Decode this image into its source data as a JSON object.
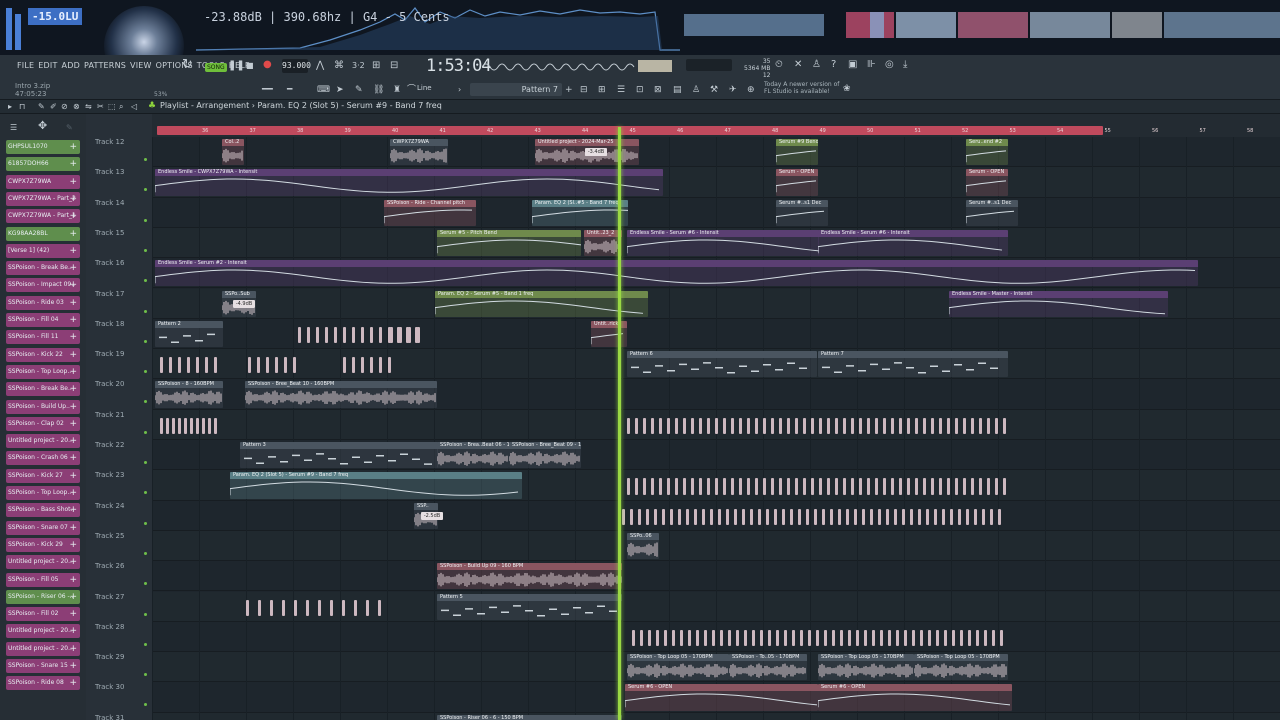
{
  "visualizer": {
    "lufs": "-15.0LU",
    "readout": "-23.88dB | 390.68hz | G4 - 5 Cents"
  },
  "menu": [
    "FILE",
    "EDIT",
    "ADD",
    "PATTERNS",
    "VIEW",
    "OPTIONS",
    "TOOLS",
    "HELP"
  ],
  "project": {
    "name": "Intro 3.zip",
    "pos": "47:05:23"
  },
  "transport": {
    "song_label": "SONG",
    "tempo": "93.000",
    "time": "1:53:04",
    "snap": "Line",
    "pattern": "Pattern 7",
    "zoom": "53%"
  },
  "memory": {
    "ram": "5364 MB",
    "cpu_top": "35",
    "cpu_bot": "12"
  },
  "news": {
    "line1": "Today  A newer version of",
    "line2": "FL Studio is available!"
  },
  "playlist": {
    "title": "Playlist - Arrangement",
    "sep": "›",
    "context": "Param. EQ 2 (Slot 5) - Serum #9 - Band 7 freq"
  },
  "ruler": [
    "36",
    "37",
    "38",
    "39",
    "40",
    "41",
    "42",
    "43",
    "44",
    "45",
    "46",
    "47",
    "48",
    "49",
    "50",
    "51",
    "52",
    "53",
    "54",
    "55",
    "56",
    "57",
    "58"
  ],
  "channels": [
    {
      "name": "GHPSUL1070",
      "color": "#5f8e4d"
    },
    {
      "name": "61857DOH66",
      "color": "#5f8e4d"
    },
    {
      "name": "CWPX7Z79WA",
      "color": "#8c3e76"
    },
    {
      "name": "CWPX7Z79WA - Part_2",
      "color": "#8c3e76"
    },
    {
      "name": "CWPX7Z79WA - Part_1",
      "color": "#8c3e76"
    },
    {
      "name": "KG98AA28BL",
      "color": "#5f8e4d"
    },
    {
      "name": "[Verse 1] (42)",
      "color": "#8c3e76"
    },
    {
      "name": "SSPoison - Break Be..",
      "color": "#8c3e76"
    },
    {
      "name": "SSPoison - Impact 09..",
      "color": "#8c3e76"
    },
    {
      "name": "SSPoison - Ride 03",
      "color": "#8c3e76"
    },
    {
      "name": "SSPoison - Fill 04",
      "color": "#8c3e76"
    },
    {
      "name": "SSPoison - Fill 11",
      "color": "#8c3e76"
    },
    {
      "name": "SSPoison - Kick 22",
      "color": "#8c3e76"
    },
    {
      "name": "SSPoison - Top Loop..",
      "color": "#8c3e76"
    },
    {
      "name": "SSPoison - Break Be..",
      "color": "#8c3e76"
    },
    {
      "name": "SSPoison - Build Up..",
      "color": "#8c3e76"
    },
    {
      "name": "SSPoison - Clap 02",
      "color": "#8c3e76"
    },
    {
      "name": "Untitled project - 20..",
      "color": "#8c3e76"
    },
    {
      "name": "SSPoison - Crash 06",
      "color": "#8c3e76"
    },
    {
      "name": "SSPoison - Kick 27",
      "color": "#8c3e76"
    },
    {
      "name": "SSPoison - Top Loop..",
      "color": "#8c3e76"
    },
    {
      "name": "SSPoison - Bass Shot..",
      "color": "#8c3e76"
    },
    {
      "name": "SSPoison - Snare 07",
      "color": "#8c3e76"
    },
    {
      "name": "SSPoison - Kick 29",
      "color": "#8c3e76"
    },
    {
      "name": "Untitled project - 20..",
      "color": "#8c3e76"
    },
    {
      "name": "SSPoison - Fill 05",
      "color": "#8c3e76"
    },
    {
      "name": "SSPoison - Riser 06 -..",
      "color": "#5f8e4d"
    },
    {
      "name": "SSPoison - Fill 02",
      "color": "#8c3e76"
    },
    {
      "name": "Untitled project - 20..",
      "color": "#8c3e76"
    },
    {
      "name": "Untitled project - 20..",
      "color": "#8c3e76"
    },
    {
      "name": "SSPoison - Snare 15",
      "color": "#8c3e76"
    },
    {
      "name": "SSPoison - Ride 08",
      "color": "#8c3e76"
    }
  ],
  "tracks": [
    "Track 12",
    "Track 13",
    "Track 14",
    "Track 15",
    "Track 16",
    "Track 17",
    "Track 18",
    "Track 19",
    "Track 20",
    "Track 21",
    "Track 22",
    "Track 23",
    "Track 24",
    "Track 25",
    "Track 26",
    "Track 27",
    "Track 28",
    "Track 29",
    "Track 30",
    "Track 31"
  ],
  "clip_labels": {
    "c1": "Col..2",
    "c2": "CWPX7Z79WA",
    "c3": "Untitled project - 2024-Mar-25",
    "c4": "Serum #9 Bend",
    "c5": "Seru..end #2",
    "c6": "Endless Smile - CWPX7Z79WA - Intensit",
    "c7": "Serum - OPEN",
    "c8": "Serum - OPEN",
    "c9": "SSPoison - Ride - Channel pitch",
    "c10": "Param. EQ 2 (Sl..#5 - Band 7 freq",
    "c11": "Serum #..s1 Dec",
    "c12": "Serum #..s1 Dec",
    "c13": "Serum #5 - Pitch Bend",
    "c14": "Untit..23_2",
    "c15": "Endless Smile - Serum #6 - Intensit",
    "c16": "Endless Smile - Serum #6 - Intensit",
    "c17": "Endless Smile - Serum #2 - Intensit",
    "c18": "SSPo..Sub",
    "c19": "Param. EQ 2 - Serum #5 - Band 1 freq",
    "c20": "Endless Smile - Master - Intensit",
    "c21": "Pattern 2",
    "c22": "Untit..rick",
    "c23": "Pattern 6",
    "c24": "Pattern 7",
    "c25": "SSPoison - 8 - 160BPM",
    "c26": "SSPoison - Bree_Beat 10 - 160BPM",
    "c27": "Pattern 3",
    "c28": "SSPoison - Brea..Beat 06 - 160BPM",
    "c29": "SSPoison - Bree_Beat 09 - 160BPM",
    "c30": "Param. EQ 2 (Slot 5) - Serum #9 - Band 7 freq",
    "c31": "SSP..",
    "c32": "SSPo..06",
    "c33": "SSPoison - Build Up 09 - 160 BPM",
    "c34": "Pattern 5",
    "c35": "SSPoison - Top Loop 05 - 170BPM",
    "c36": "SSPoison - To..05 - 170BPM",
    "c37": "SSPoison - Top Loop 05 - 170BPM",
    "c38": "SSPoison - Top Loop 05 - 170BPM",
    "c39": "Serum #6 - OPEN",
    "c40": "Serum #6 - OPEN",
    "c41": "SSPoison - Riser 06 - 6 - 150 BPM"
  },
  "gain_labels": {
    "g1": "-3.4dB",
    "g2": "-4.9dB",
    "g3": "-2.5dB"
  },
  "colors": {
    "purple_clip": "#5b3f73",
    "pink_clip": "#8a5560",
    "green_clip": "#6f8a4c",
    "teal_clip": "#5a7f86",
    "gray_clip": "#4a5560",
    "loop_bar": "#c04a5d",
    "playhead": "#9ad844"
  }
}
